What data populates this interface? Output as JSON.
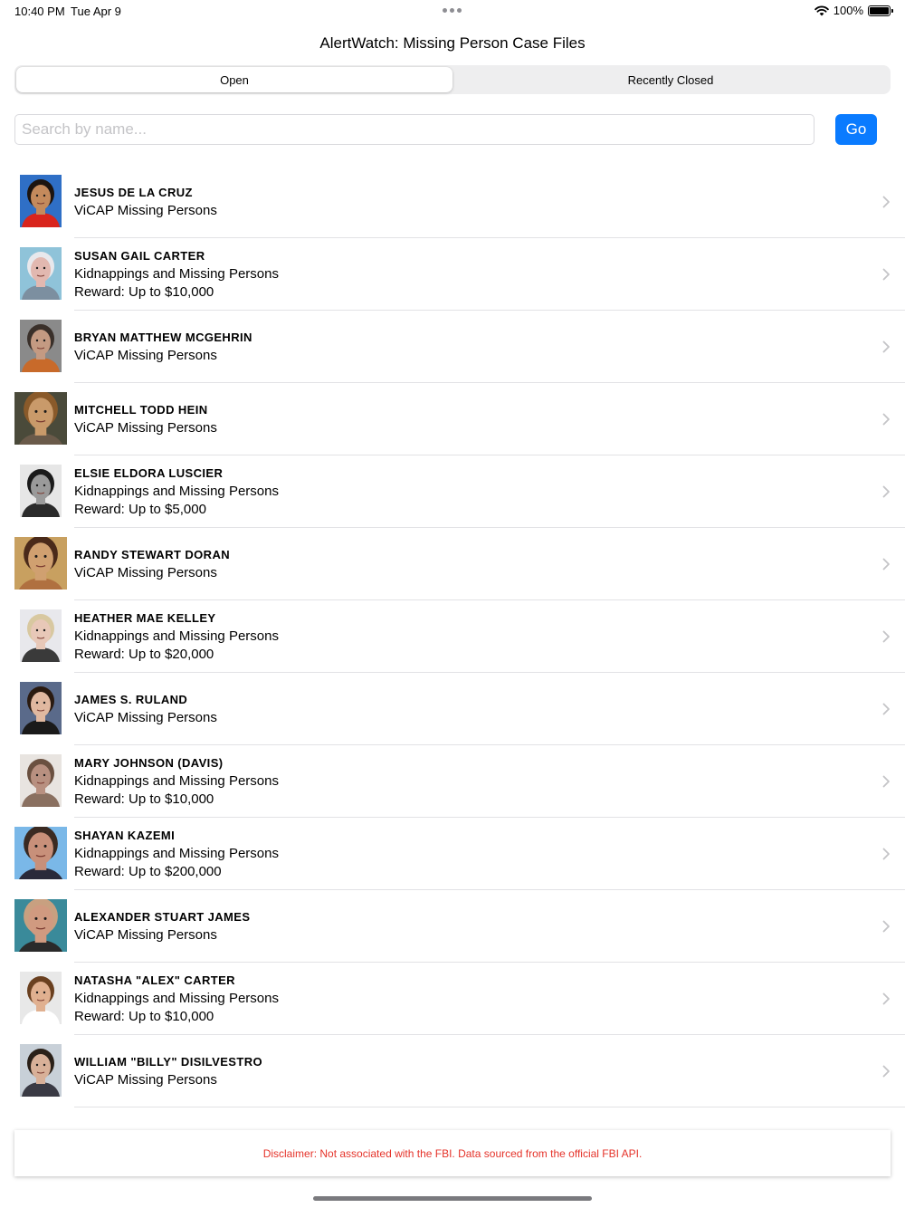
{
  "status_bar": {
    "time": "10:40 PM",
    "date": "Tue Apr 9",
    "battery": "100%",
    "battery_level": 1.0
  },
  "nav": {
    "title": "AlertWatch: Missing Person Case Files"
  },
  "segments": [
    {
      "label": "Open",
      "selected": true
    },
    {
      "label": "Recently Closed",
      "selected": false
    }
  ],
  "search": {
    "placeholder": "Search by name...",
    "value": "",
    "go_label": "Go"
  },
  "cases": [
    {
      "name": "JESUS DE LA CRUZ",
      "category": "ViCAP Missing Persons",
      "reward": ""
    },
    {
      "name": "SUSAN GAIL CARTER",
      "category": "Kidnappings and Missing Persons",
      "reward": "Reward: Up to $10,000"
    },
    {
      "name": "BRYAN MATTHEW MCGEHRIN",
      "category": "ViCAP Missing Persons",
      "reward": ""
    },
    {
      "name": "MITCHELL TODD HEIN",
      "category": "ViCAP Missing Persons",
      "reward": ""
    },
    {
      "name": "ELSIE ELDORA LUSCIER",
      "category": "Kidnappings and Missing Persons",
      "reward": "Reward: Up to $5,000"
    },
    {
      "name": "RANDY STEWART DORAN",
      "category": "ViCAP Missing Persons",
      "reward": ""
    },
    {
      "name": "HEATHER MAE KELLEY",
      "category": "Kidnappings and Missing Persons",
      "reward": "Reward: Up to $20,000"
    },
    {
      "name": "JAMES S. RULAND",
      "category": "ViCAP Missing Persons",
      "reward": ""
    },
    {
      "name": "MARY JOHNSON (DAVIS)",
      "category": "Kidnappings and Missing Persons",
      "reward": "Reward: Up to $10,000"
    },
    {
      "name": "SHAYAN KAZEMI",
      "category": "Kidnappings and Missing Persons",
      "reward": "Reward: Up to $200,000"
    },
    {
      "name": "ALEXANDER STUART JAMES",
      "category": "ViCAP Missing Persons",
      "reward": ""
    },
    {
      "name": "NATASHA \"ALEX\" CARTER",
      "category": "Kidnappings and Missing Persons",
      "reward": "Reward: Up to $10,000"
    },
    {
      "name": "WILLIAM \"BILLY\" DISILVESTRO",
      "category": "ViCAP Missing Persons",
      "reward": ""
    }
  ],
  "photos": [
    {
      "bg": "#2f6fc6",
      "skin": "#c48a5c",
      "hair": "#1c1410",
      "shirt": "#d9241c"
    },
    {
      "bg": "#8fc3d9",
      "skin": "#e2b8b0",
      "hair": "#e8e8ec",
      "shirt": "#7c8fa0"
    },
    {
      "bg": "#8a8a8a",
      "skin": "#c49a82",
      "hair": "#3a302a",
      "shirt": "#c86a2a"
    },
    {
      "bg": "#4a4a3a",
      "skin": "#c99a6a",
      "hair": "#8a5a2a",
      "shirt": "#6a5a4a"
    },
    {
      "bg": "#e6e6e6",
      "skin": "#9a9a9a",
      "hair": "#1a1a1a",
      "shirt": "#2a2a2a"
    },
    {
      "bg": "#c8a060",
      "skin": "#d0a070",
      "hair": "#4a2a1a",
      "shirt": "#b07040"
    },
    {
      "bg": "#e8e8ec",
      "skin": "#e8c8b8",
      "hair": "#d8c8a0",
      "shirt": "#3a3a3a"
    },
    {
      "bg": "#5a6a8a",
      "skin": "#e0b8a0",
      "hair": "#2a1a10",
      "shirt": "#1a1a1a"
    },
    {
      "bg": "#e8e4e0",
      "skin": "#b89080",
      "hair": "#6a5040",
      "shirt": "#8a7060"
    },
    {
      "bg": "#7ab8e8",
      "skin": "#c8907a",
      "hair": "#3a2a22",
      "shirt": "#2a2a3a"
    },
    {
      "bg": "#3a8a9a",
      "skin": "#d09a80",
      "hair": "#c8a080",
      "shirt": "#2a2a2a"
    },
    {
      "bg": "#e8e8e8",
      "skin": "#e0b090",
      "hair": "#6a4020",
      "shirt": "#ffffff"
    },
    {
      "bg": "#c8d0d8",
      "skin": "#d8b098",
      "hair": "#2a2018",
      "shirt": "#3a3a44"
    }
  ],
  "disclaimer": "Disclaimer: Not associated with the FBI. Data sourced from the official FBI API.",
  "colors": {
    "accent": "#0a7bff",
    "disclaimer_text": "#e5332a",
    "separator": "#e2e2e5"
  }
}
